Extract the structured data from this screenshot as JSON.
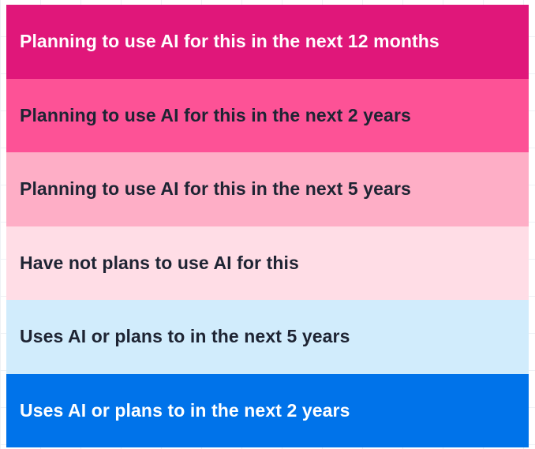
{
  "chart_data": {
    "type": "legend",
    "legend": [
      {
        "label": "Planning to use AI for this in the next 12 months",
        "color": "#e0177a",
        "text_color": "#ffffff"
      },
      {
        "label": "Planning to use AI for this in the next 2 years",
        "color": "#fd5296",
        "text_color": "#1e2433"
      },
      {
        "label": "Planning to use AI for this in the next 5 years",
        "color": "#feaec6",
        "text_color": "#1e2433"
      },
      {
        "label": "Have not plans to use AI for this",
        "color": "#ffdde6",
        "text_color": "#1e2433"
      },
      {
        "label": "Uses AI or plans to in the next 5 years",
        "color": "#d1ecfc",
        "text_color": "#1e2433"
      },
      {
        "label": "Uses AI or plans to in the next 2 years",
        "color": "#0073ea",
        "text_color": "#ffffff"
      }
    ]
  }
}
